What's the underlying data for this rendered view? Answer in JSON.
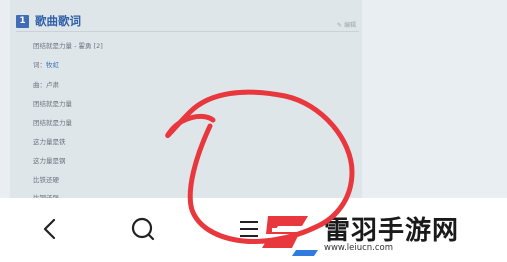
{
  "section": {
    "number": "1",
    "title": "歌曲歌词",
    "edit_label": "编辑"
  },
  "lyrics": [
    {
      "text": "团结就是力量 - 霍勇 [2]"
    },
    {
      "prefix": "词：",
      "link": "牧虹"
    },
    {
      "text": "曲：卢肃"
    },
    {
      "text": "团结就是力量"
    },
    {
      "text": "团结就是力量"
    },
    {
      "text": "这力量是铁"
    },
    {
      "text": "这力量是钢"
    },
    {
      "text": "比铁还硬"
    },
    {
      "text": "比钢还强"
    }
  ],
  "navbar": {
    "back_icon": "chevron-left-icon",
    "search_icon": "search-icon",
    "menu_icon": "menu-icon"
  },
  "watermark": {
    "name": "雷羽手游网",
    "url": "www.leiucn.com"
  },
  "annotation_color": "#e8383d"
}
